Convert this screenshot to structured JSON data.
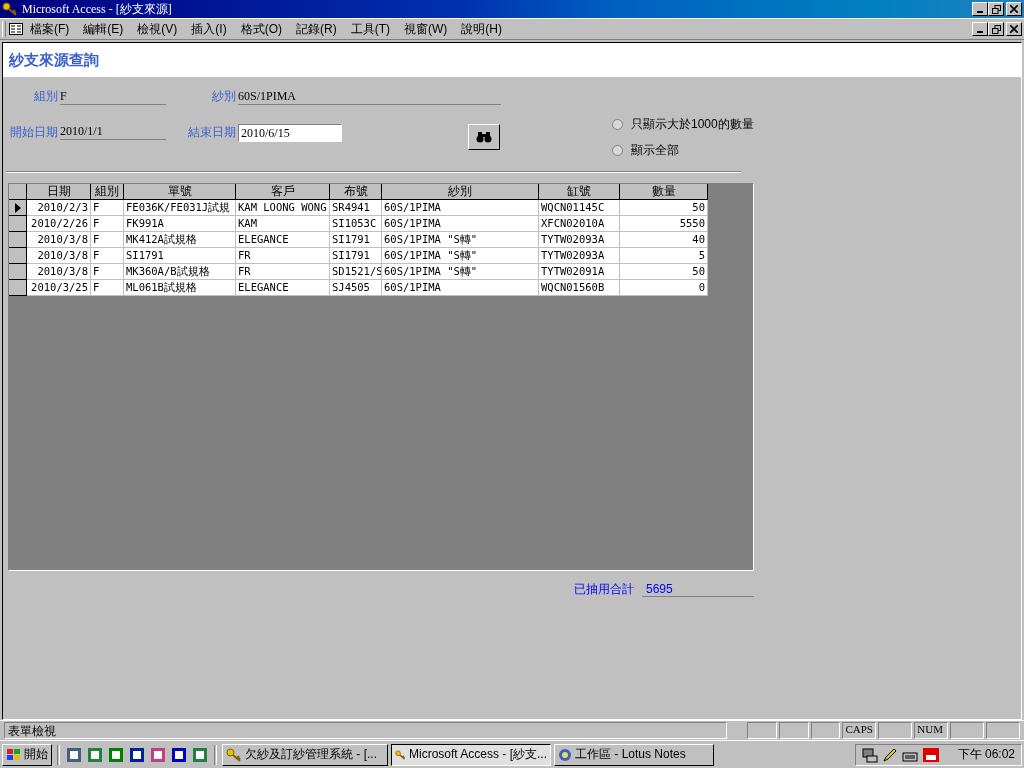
{
  "window": {
    "title": "Microsoft Access - [紗支來源]"
  },
  "menu": [
    "檔案(F)",
    "編輯(E)",
    "檢視(V)",
    "插入(I)",
    "格式(O)",
    "記錄(R)",
    "工具(T)",
    "視窗(W)",
    "說明(H)"
  ],
  "form": {
    "title": "紗支來源查詢",
    "fields_top": [
      {
        "label": "組別",
        "value": "F"
      },
      {
        "label": "紗別",
        "value": "60S/1PIMA"
      }
    ],
    "start_date": {
      "label": "開始日期",
      "value": "2010/1/1"
    },
    "end_date": {
      "label": "結束日期",
      "value": "2010/6/15"
    },
    "options": [
      {
        "label": "只顯示大於1000的數量",
        "selected": false
      },
      {
        "label": "顯示全部",
        "selected": false
      }
    ],
    "table": {
      "columns": [
        "日期",
        "組別",
        "單號",
        "客戶",
        "布號",
        "紗別",
        "缸號",
        "數量"
      ],
      "rows": [
        {
          "current": true,
          "cells": [
            "2010/2/3",
            "F",
            "FE036K/FE031J試規",
            "KAM LOONG WONG",
            "SR4941",
            "60S/1PIMA",
            "WQCN01145C",
            "50"
          ]
        },
        {
          "current": false,
          "cells": [
            "2010/2/26",
            "F",
            "FK991A",
            "KAM",
            "SI1053C",
            "60S/1PIMA",
            "XFCN02010A",
            "5550"
          ]
        },
        {
          "current": false,
          "cells": [
            "2010/3/8",
            "F",
            "MK412A試規格",
            "ELEGANCE",
            "SI1791",
            "60S/1PIMA \"S轉\"",
            "TYTW02093A",
            "40"
          ]
        },
        {
          "current": false,
          "cells": [
            "2010/3/8",
            "F",
            "SI1791",
            "FR",
            "SI1791",
            "60S/1PIMA \"S轉\"",
            "TYTW02093A",
            "5"
          ]
        },
        {
          "current": false,
          "cells": [
            "2010/3/8",
            "F",
            "MK360A/B試規格",
            "FR",
            "SD1521/S",
            "60S/1PIMA \"S轉\"",
            "TYTW02091A",
            "50"
          ]
        },
        {
          "current": false,
          "cells": [
            "2010/3/25",
            "F",
            "ML061B試規格",
            "ELEGANCE",
            "SJ4505",
            "60S/1PIMA",
            "WQCN01560B",
            "0"
          ]
        }
      ]
    },
    "total": {
      "label": "已抽用合計",
      "value": "5695"
    }
  },
  "status_bar": {
    "text": "表單檢視",
    "indicators": [
      {
        "text": "CAPS"
      },
      {
        "text": "NUM"
      }
    ]
  },
  "taskbar": {
    "start": "開始",
    "tasks": [
      {
        "label": "欠紗及訂紗管理系統 - [...",
        "selected": false
      },
      {
        "label": "Microsoft Access - [紗支...",
        "selected": true
      },
      {
        "label": "工作區 - Lotus Notes",
        "selected": false
      }
    ],
    "clock": "下午 06:02"
  }
}
